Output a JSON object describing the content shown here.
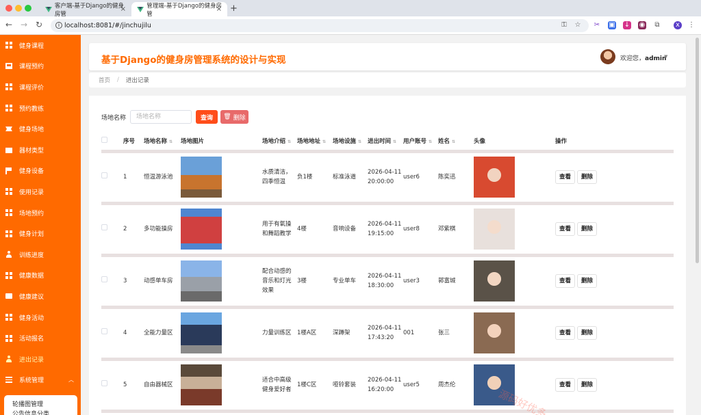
{
  "browser": {
    "tabs": [
      {
        "title": "客户端-基于Django的健身房管"
      },
      {
        "title": "管理端-基于Django的健身房管"
      }
    ],
    "url": "localhost:8081/#/jinchujilu",
    "profile_initial": "x"
  },
  "sidebar": {
    "items": [
      {
        "label": "健身课程",
        "icon": "grid-icon"
      },
      {
        "label": "课程预约",
        "icon": "monitor-icon"
      },
      {
        "label": "课程评价",
        "icon": "grid-icon"
      },
      {
        "label": "预约教练",
        "icon": "grid-icon"
      },
      {
        "label": "健身场地",
        "icon": "ticket-icon"
      },
      {
        "label": "器材类型",
        "icon": "briefcase-icon"
      },
      {
        "label": "健身设备",
        "icon": "flag-icon"
      },
      {
        "label": "使用记录",
        "icon": "grid-icon"
      },
      {
        "label": "场地预约",
        "icon": "grid-icon"
      },
      {
        "label": "健身计划",
        "icon": "grid-icon"
      },
      {
        "label": "训练进度",
        "icon": "user-icon"
      },
      {
        "label": "健康数据",
        "icon": "grid-icon"
      },
      {
        "label": "健康建议",
        "icon": "message-icon"
      },
      {
        "label": "健身活动",
        "icon": "grid-icon"
      },
      {
        "label": "活动报名",
        "icon": "grid-icon"
      },
      {
        "label": "进出记录",
        "icon": "person-icon"
      },
      {
        "label": "系统管理",
        "icon": "menu-icon"
      }
    ],
    "submenu": [
      "轮播图管理",
      "公告信息分类"
    ]
  },
  "header": {
    "title": "基于Django的健身房管理系统的设计与实现",
    "welcome_prefix": "欢迎您，",
    "username": "admin"
  },
  "breadcrumb": {
    "home": "首页",
    "current": "进出记录"
  },
  "search": {
    "label": "场地名称",
    "placeholder": "场地名称",
    "query_button": "查询",
    "delete_button": "删除"
  },
  "table": {
    "columns": [
      "序号",
      "场地名称",
      "场地图片",
      "场地介绍",
      "场地地址",
      "场地设施",
      "进出时间",
      "用户账号",
      "姓名",
      "头像",
      "操作"
    ],
    "rows": [
      {
        "no": "1",
        "name": "恒温游泳池",
        "intro": "水质清洁，四季恒温",
        "address": "负1楼",
        "facility": "标准泳道",
        "time_date": "2026-04-11",
        "time_clock": "20:00:00",
        "account": "user6",
        "person": "陈奕迅"
      },
      {
        "no": "2",
        "name": "多功能操房",
        "intro": "用于有氧操和舞蹈教学",
        "address": "4楼",
        "facility": "音响设备",
        "time_date": "2026-04-11",
        "time_clock": "19:15:00",
        "account": "user8",
        "person": "邓紫棋"
      },
      {
        "no": "3",
        "name": "动感单车房",
        "intro": "配合动感的音乐和灯光效果",
        "address": "3楼",
        "facility": "专业单车",
        "time_date": "2026-04-11",
        "time_clock": "18:30:00",
        "account": "user3",
        "person": "郭富城"
      },
      {
        "no": "4",
        "name": "全能力量区",
        "intro": "力量训练区",
        "address": "1楼A区",
        "facility": "深蹲架",
        "time_date": "2026-04-11",
        "time_clock": "17:43:20",
        "account": "001",
        "person": "张三"
      },
      {
        "no": "5",
        "name": "自由器械区",
        "intro": "适合中高级健身爱好者",
        "address": "1楼C区",
        "facility": "哑铃套装",
        "time_date": "2026-04-11",
        "time_clock": "16:20:00",
        "account": "user5",
        "person": "周杰伦"
      }
    ],
    "view_label": "查看",
    "delete_label": "删除"
  },
  "watermark": "源码好优多",
  "colors": {
    "accent": "#ff6a00",
    "query": "#ff4d1a",
    "danger": "#e86a6a"
  }
}
